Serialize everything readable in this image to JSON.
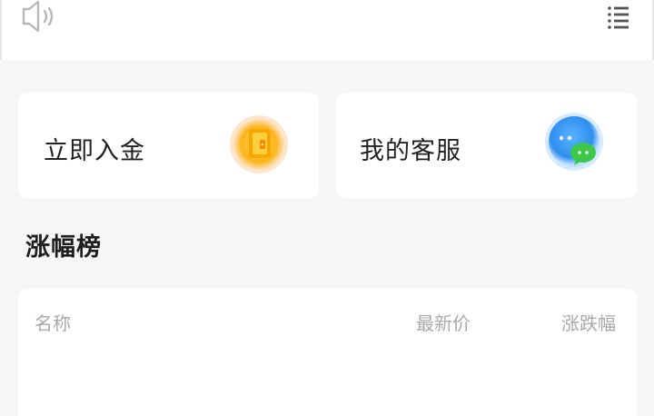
{
  "header": {
    "left_icon": "speaker-icon",
    "right_icon": "menu-list-icon"
  },
  "quick_actions": [
    {
      "label": "立即入金",
      "icon": "deposit-wallet-icon",
      "color": "#fbb51c"
    },
    {
      "label": "我的客服",
      "icon": "customer-service-chat-icon",
      "color": "#2f8ef0"
    }
  ],
  "gainers": {
    "title": "涨幅榜",
    "columns": [
      "名称",
      "最新价",
      "涨跌幅"
    ],
    "rows": []
  },
  "colors": {
    "background": "#f6f6f6",
    "card": "#ffffff",
    "text_primary": "#222222",
    "text_muted": "#a8a8a8",
    "accent_gold": "#fbb51c",
    "accent_blue": "#2f8ef0",
    "accent_green": "#3cc84a"
  }
}
